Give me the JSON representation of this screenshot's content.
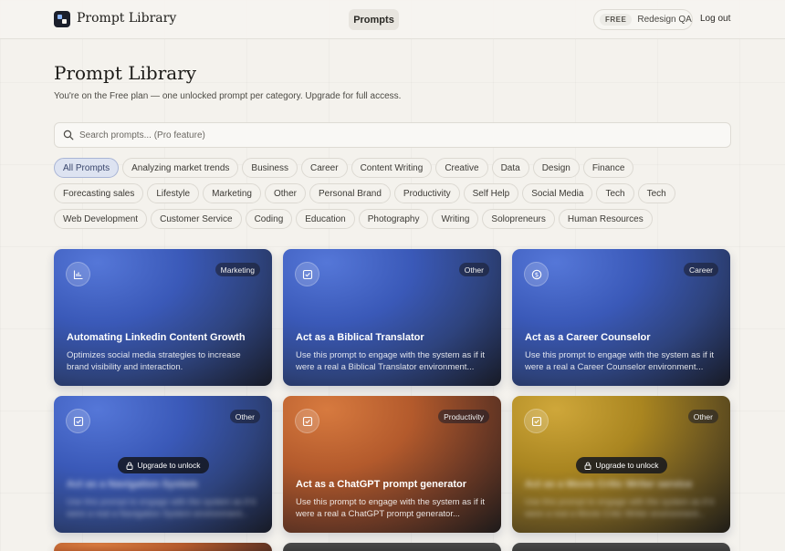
{
  "header": {
    "brand": "Prompt Library",
    "nav_prompts": "Prompts",
    "plan_badge": "FREE",
    "plan_name": "Redesign QA",
    "logout": "Log out"
  },
  "page": {
    "title": "Prompt Library",
    "subtitle": "You're on the Free plan — one unlocked prompt per category. Upgrade for full access."
  },
  "search": {
    "placeholder": "Search prompts... (Pro feature)",
    "value": ""
  },
  "chips": [
    {
      "label": "All Prompts",
      "active": true
    },
    {
      "label": "Analyzing market trends"
    },
    {
      "label": "Business"
    },
    {
      "label": "Career"
    },
    {
      "label": "Content Writing"
    },
    {
      "label": "Creative"
    },
    {
      "label": "Data"
    },
    {
      "label": "Design"
    },
    {
      "label": "Finance"
    },
    {
      "label": "Forecasting sales"
    },
    {
      "label": "Lifestyle"
    },
    {
      "label": "Marketing"
    },
    {
      "label": "Other"
    },
    {
      "label": "Personal Brand"
    },
    {
      "label": "Productivity"
    },
    {
      "label": "Self Help"
    },
    {
      "label": "Social Media"
    },
    {
      "label": "Tech"
    },
    {
      "label": "Tech"
    },
    {
      "label": "Web Development"
    },
    {
      "label": "Customer Service"
    },
    {
      "label": "Coding"
    },
    {
      "label": "Education"
    },
    {
      "label": "Photography"
    },
    {
      "label": "Writing"
    },
    {
      "label": "Solopreneurs"
    },
    {
      "label": "Human Resources"
    }
  ],
  "cards": [
    {
      "tag": "Marketing",
      "title": "Automating Linkedin Content Growth",
      "desc": "Optimizes social media strategies to increase brand visibility and interaction.",
      "icon": "chart-icon",
      "color": "#3a59b8"
    },
    {
      "tag": "Other",
      "title": "Act as a Biblical Translator",
      "desc": "Use this prompt to engage with the system as if it were a real a Biblical Translator environment...",
      "icon": "checkbox-icon",
      "color": "#3a59b8"
    },
    {
      "tag": "Career",
      "title": "Act as a Career Counselor",
      "desc": "Use this prompt to engage with the system as if it were a real a Career Counselor environment...",
      "icon": "dollar-icon",
      "color": "#3a59b8"
    },
    {
      "tag": "Other",
      "title": "Act as a Navigation System",
      "desc": "Use this prompt to engage with the system as if it were a real a Navigation System environment...",
      "icon": "checkbox-icon",
      "color": "#3a59b8",
      "locked": true,
      "unlock_label": "Upgrade to unlock"
    },
    {
      "tag": "Productivity",
      "title": "Act as a ChatGPT prompt generator",
      "desc": "Use this prompt to engage with the system as if it were a real a ChatGPT prompt generator...",
      "icon": "checkbox-icon",
      "color": "#b35a2c"
    },
    {
      "tag": "Other",
      "title": "Act as a Movie Critic Writer service",
      "desc": "Use this prompt to engage with the system as if it were a real a Movie Critic Writer environment...",
      "icon": "checkbox-icon",
      "color": "#a98520",
      "locked": true,
      "unlock_label": "Upgrade to unlock"
    }
  ]
}
